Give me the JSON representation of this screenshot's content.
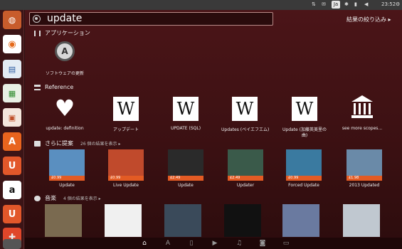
{
  "top_panel": {
    "keyboard": "Ja",
    "clock": "23:52"
  },
  "search": {
    "query": "update",
    "filter_label": "結果の絞り込み ▸"
  },
  "categories": {
    "applications": {
      "title": "アプリケーション"
    },
    "reference": {
      "title": "Reference"
    },
    "suggestions": {
      "title": "さらに提案",
      "count": "26 個の結果を表示 ▸"
    },
    "music": {
      "title": "音楽",
      "count": "4 個の結果を表示 ▸"
    }
  },
  "apps": [
    {
      "label": "ソフトウェアの更新",
      "icon": "software-updater-icon"
    }
  ],
  "reference": [
    {
      "label": "update: definition",
      "icon": "heart-icon"
    },
    {
      "label": "アップデート",
      "icon": "wikipedia-icon"
    },
    {
      "label": "UPDATE (SQL)",
      "icon": "wikipedia-icon"
    },
    {
      "label": "Updates (ベイエフエム)",
      "icon": "wikipedia-icon"
    },
    {
      "label": "Update (加藤英美里の",
      "label2": "曲)",
      "icon": "wikipedia-icon"
    },
    {
      "label": "see more scopes...",
      "icon": "building-icon"
    }
  ],
  "suggestions": [
    {
      "label": "Update",
      "price": "£0.99",
      "color": "#5a8fc0"
    },
    {
      "label": "Live Update",
      "price": "£0.99",
      "color": "#c04a2c"
    },
    {
      "label": "Update",
      "price": "£2.49",
      "color": "#2a2a2a"
    },
    {
      "label": "Updater",
      "price": "£2.49",
      "color": "#3a5a4a"
    },
    {
      "label": "Forced Update",
      "price": "£0.99",
      "color": "#3a7aa0"
    },
    {
      "label": "2013 Updated",
      "price": "£1.98",
      "color": "#6a8aa8"
    }
  ],
  "music_colors": [
    "#7a6a50",
    "#f0f0f0",
    "#3a4a5a",
    "#111111",
    "#6a7aa0",
    "#c0c8d0"
  ],
  "lenses": [
    "home-lens-icon",
    "apps-lens-icon",
    "files-lens-icon",
    "video-lens-icon",
    "music-lens-icon",
    "photos-lens-icon",
    "social-lens-icon"
  ]
}
